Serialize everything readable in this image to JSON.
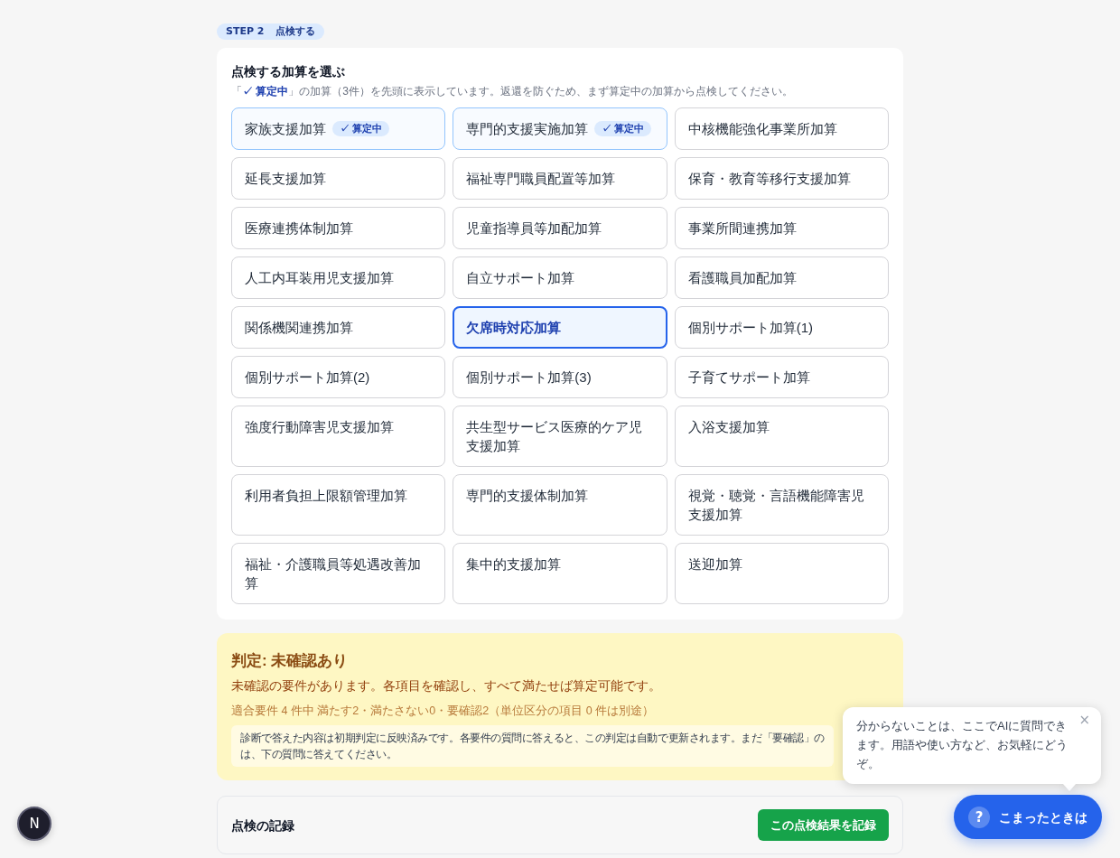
{
  "step": {
    "label": "STEP 2",
    "title": "点検する"
  },
  "picker": {
    "title": "点検する加算を選ぶ",
    "description": "「**✓ 算定中**」の加算（3件）を先頭に表示しています。返還を防ぐため、まず算定中の加算から点検してください。",
    "items": [
      {
        "label": "家族支援加算",
        "calculating": true,
        "selected": false,
        "badge": "✓ 算定中"
      },
      {
        "label": "専門的支援実施加算",
        "calculating": true,
        "selected": false,
        "badge": "✓ 算定中"
      },
      {
        "label": "中核機能強化事業所加算",
        "calculating": false,
        "selected": false
      },
      {
        "label": "延長支援加算",
        "calculating": false,
        "selected": false
      },
      {
        "label": "福祉専門職員配置等加算",
        "calculating": false,
        "selected": false
      },
      {
        "label": "保育・教育等移行支援加算",
        "calculating": false,
        "selected": false
      },
      {
        "label": "医療連携体制加算",
        "calculating": false,
        "selected": false
      },
      {
        "label": "児童指導員等加配加算",
        "calculating": false,
        "selected": false
      },
      {
        "label": "事業所間連携加算",
        "calculating": false,
        "selected": false
      },
      {
        "label": "人工内耳装用児支援加算",
        "calculating": false,
        "selected": false
      },
      {
        "label": "自立サポート加算",
        "calculating": false,
        "selected": false
      },
      {
        "label": "看護職員加配加算",
        "calculating": false,
        "selected": false
      },
      {
        "label": "関係機関連携加算",
        "calculating": false,
        "selected": false
      },
      {
        "label": "欠席時対応加算",
        "calculating": false,
        "selected": true
      },
      {
        "label": "個別サポート加算(1)",
        "calculating": false,
        "selected": false
      },
      {
        "label": "個別サポート加算(2)",
        "calculating": false,
        "selected": false
      },
      {
        "label": "個別サポート加算(3)",
        "calculating": false,
        "selected": false
      },
      {
        "label": "子育てサポート加算",
        "calculating": false,
        "selected": false
      },
      {
        "label": "強度行動障害児支援加算",
        "calculating": false,
        "selected": false
      },
      {
        "label": "共生型サービス医療的ケア児支援加算",
        "calculating": false,
        "selected": false
      },
      {
        "label": "入浴支援加算",
        "calculating": false,
        "selected": false
      },
      {
        "label": "利用者負担上限額管理加算",
        "calculating": false,
        "selected": false
      },
      {
        "label": "専門的支援体制加算",
        "calculating": false,
        "selected": false
      },
      {
        "label": "視覚・聴覚・言語機能障害児支援加算",
        "calculating": false,
        "selected": false
      },
      {
        "label": "福祉・介護職員等処遇改善加算",
        "calculating": false,
        "selected": false
      },
      {
        "label": "集中的支援加算",
        "calculating": false,
        "selected": false
      },
      {
        "label": "送迎加算",
        "calculating": false,
        "selected": false
      }
    ]
  },
  "verdict": {
    "title": "判定: 未確認あり",
    "message": "未確認の要件があります。各項目を確認し、すべて満たせば算定可能です。",
    "summary": "適合要件 4 件中 満たす2・満たさない0・要確認2（単位区分の項目 0 件は別途）",
    "note_lines": [
      "診断で答えた内容は初期判定に反映済みです。各要件の質問に答えると、この判定は自動で更新されます。まだ「要確認」の",
      "は、下の質問に答えてください。"
    ]
  },
  "record": {
    "title": "点検の記録",
    "button": "この点検結果を記録"
  },
  "help_bubble": {
    "text": "分からないことは、ここでAIに質問できます。用語や使い方など、お気軽にどうぞ。",
    "close": "×"
  },
  "help_button": {
    "icon": "?",
    "label": "こまったときは"
  },
  "dev_indicator": {
    "letter": "N"
  }
}
